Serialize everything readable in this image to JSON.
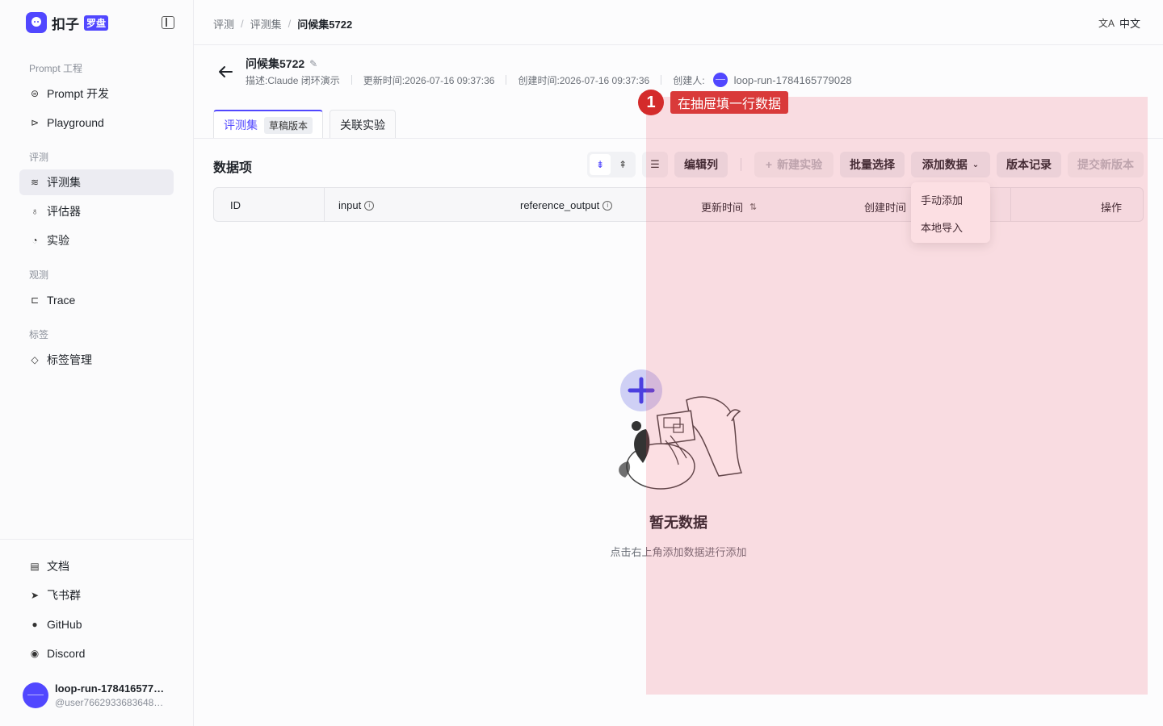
{
  "brand": {
    "name": "扣子",
    "tag": "罗盘"
  },
  "sidebar": {
    "sections": [
      {
        "title": "Prompt 工程",
        "items": [
          {
            "label": "Prompt 开发",
            "icon": "prompt-icon"
          },
          {
            "label": "Playground",
            "icon": "play-icon"
          }
        ]
      },
      {
        "title": "评测",
        "items": [
          {
            "label": "评测集",
            "icon": "database-icon",
            "active": true
          },
          {
            "label": "评估器",
            "icon": "bulb-icon"
          },
          {
            "label": "实验",
            "icon": "gauge-icon"
          }
        ]
      },
      {
        "title": "观测",
        "items": [
          {
            "label": "Trace",
            "icon": "trace-icon"
          }
        ]
      },
      {
        "title": "标签",
        "items": [
          {
            "label": "标签管理",
            "icon": "tag-icon"
          }
        ]
      }
    ],
    "links": [
      {
        "label": "文档",
        "icon": "doc-icon"
      },
      {
        "label": "飞书群",
        "icon": "feishu-icon"
      },
      {
        "label": "GitHub",
        "icon": "github-icon"
      },
      {
        "label": "Discord",
        "icon": "discord-icon"
      }
    ],
    "user": {
      "name": "loop-run-178416577…",
      "handle": "@user7662933683648…"
    }
  },
  "topbar": {
    "breadcrumb": [
      "评测",
      "评测集",
      "问候集5722"
    ],
    "language": "中文"
  },
  "header": {
    "title": "问候集5722",
    "description": "描述:Claude 闭环演示",
    "updated": "更新时间:2026-07-16 09:37:36",
    "created": "创建时间:2026-07-16 09:37:36",
    "creator_label": "创建人:",
    "creator": "loop-run-1784165779028"
  },
  "tabs": [
    {
      "label": "评测集",
      "badge": "草稿版本",
      "active": true
    },
    {
      "label": "关联实验"
    }
  ],
  "toolbar": {
    "section_title": "数据项",
    "edit_columns": "编辑列",
    "new_experiment": "新建实验",
    "batch_select": "批量选择",
    "add_data": "添加数据",
    "version_history": "版本记录",
    "submit_version": "提交新版本"
  },
  "table": {
    "columns": [
      "ID",
      "input",
      "reference_output",
      "更新时间",
      "创建时间",
      "操作"
    ]
  },
  "add_data_menu": [
    "手动添加",
    "本地导入"
  ],
  "empty": {
    "title": "暂无数据",
    "subtitle": "点击右上角添加数据进行添加"
  },
  "annotation": {
    "number": "1",
    "label": "在抽屉填一行数据"
  },
  "colors": {
    "accent": "#5147ff",
    "annotation": "#d93a3a"
  }
}
